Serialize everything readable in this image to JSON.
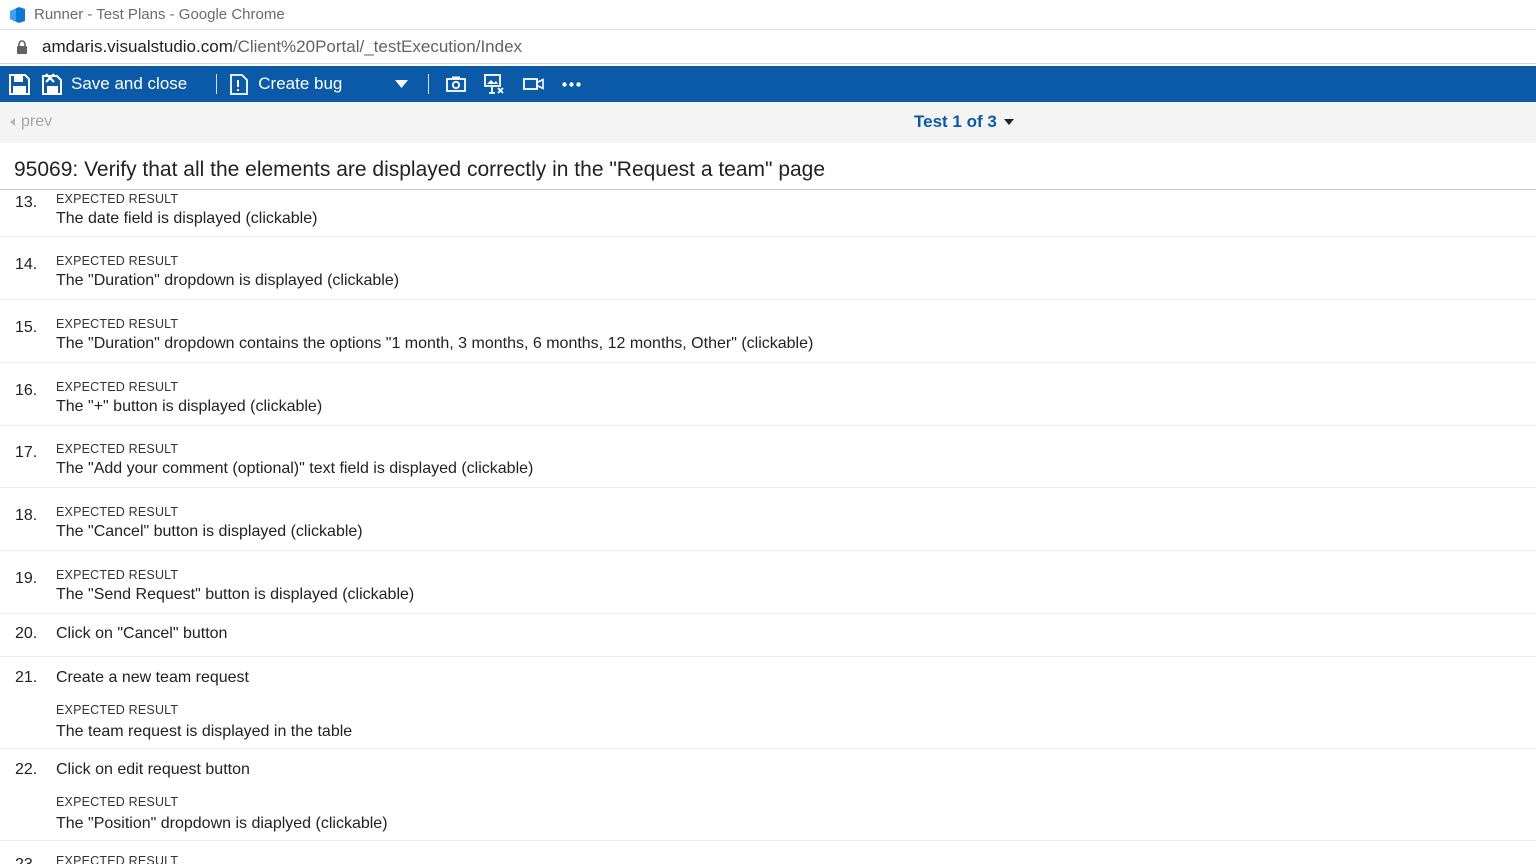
{
  "window": {
    "title": "Runner - Test Plans - Google Chrome"
  },
  "address": {
    "host": "amdaris.visualstudio.com",
    "path": "/Client%20Portal/_testExecution/Index"
  },
  "toolbar": {
    "save_close_label": "Save and close",
    "create_bug_label": "Create bug"
  },
  "nav": {
    "prev_label": "prev",
    "counter_label": "Test 1 of 3"
  },
  "test": {
    "title": "95069: Verify that all the elements are displayed correctly in the \"Request a team\" page"
  },
  "expected_label": "EXPECTED RESULT",
  "steps": [
    {
      "num": "13.",
      "action": "",
      "expected_label": "EXPECTED RESULT",
      "expected": "The date field is displayed (clickable)"
    },
    {
      "num": "14.",
      "action": "",
      "expected_label": "EXPECTED RESULT",
      "expected": "The \"Duration\" dropdown is displayed (clickable)"
    },
    {
      "num": "15.",
      "action": "",
      "expected_label": "EXPECTED RESULT",
      "expected": "The \"Duration\" dropdown contains the options \"1 month, 3 months, 6 months, 12 months, Other\" (clickable)"
    },
    {
      "num": "16.",
      "action": "",
      "expected_label": "EXPECTED RESULT",
      "expected": "The \"+\" button is displayed (clickable)"
    },
    {
      "num": "17.",
      "action": "",
      "expected_label": "EXPECTED RESULT",
      "expected": "The \"Add your comment (optional)\" text field is displayed (clickable)"
    },
    {
      "num": "18.",
      "action": "",
      "expected_label": "EXPECTED RESULT",
      "expected": "The \"Cancel\" button is displayed (clickable)"
    },
    {
      "num": "19.",
      "action": "",
      "expected_label": "EXPECTED RESULT",
      "expected": "The \"Send Request\" button is displayed (clickable)"
    },
    {
      "num": "20.",
      "action": "Click on \"Cancel\" button",
      "expected_label": "",
      "expected": ""
    },
    {
      "num": "21.",
      "action": "Create a new team request",
      "expected_label": "EXPECTED RESULT",
      "expected": "The team request is displayed in the table"
    },
    {
      "num": "22.",
      "action": "Click on edit request button",
      "expected_label": "EXPECTED RESULT",
      "expected": "The \"Position\" dropdown is diaplyed (clickable)"
    },
    {
      "num": "23.",
      "action": "",
      "expected_label": "EXPECTED RESULT",
      "expected": ""
    }
  ],
  "icons": {
    "app": "azure-devops-icon",
    "lock": "lock-icon",
    "save": "save-icon",
    "save_close": "save-close-icon",
    "create_bug": "create-bug-icon",
    "dropdown": "chevron-down-icon",
    "screenshot": "camera-icon",
    "capture_image": "capture-image-icon",
    "record_video": "video-icon",
    "more": "more-icon"
  },
  "colors": {
    "toolbar_bg": "#0a5aa8",
    "link": "#0a5aa8",
    "nav_bg": "#f4f4f4"
  }
}
